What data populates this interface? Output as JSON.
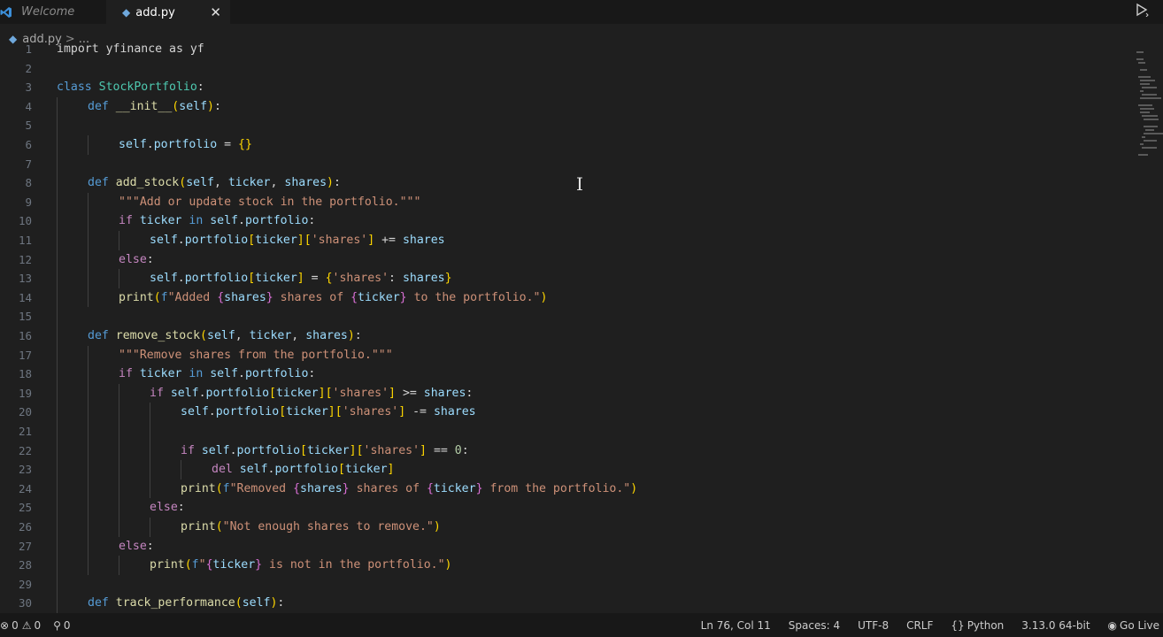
{
  "tabs": [
    {
      "label": "Welcome",
      "icon": "vscode-icon"
    },
    {
      "label": "add.py",
      "icon": "python-icon",
      "close": "✕"
    }
  ],
  "breadcrumb": {
    "file": "add.py",
    "separator": ">",
    "more": "..."
  },
  "code_lines": [
    {
      "n": "1",
      "indent": 0,
      "tokens": [
        [
          "plain",
          "import yfinance as yf"
        ]
      ]
    },
    {
      "n": "2",
      "indent": 0,
      "tokens": []
    },
    {
      "n": "3",
      "indent": 0,
      "tokens": [
        [
          "kw",
          "class "
        ],
        [
          "cls",
          "StockPortfolio"
        ],
        [
          "plain",
          ":"
        ]
      ]
    },
    {
      "n": "4",
      "indent": 1,
      "tokens": [
        [
          "kw",
          "def "
        ],
        [
          "fn",
          "__init__"
        ],
        [
          "brk",
          "("
        ],
        [
          "var",
          "self"
        ],
        [
          "brk",
          ")"
        ],
        [
          "plain",
          ":"
        ]
      ]
    },
    {
      "n": "5",
      "indent": 0,
      "tokens": []
    },
    {
      "n": "6",
      "indent": 2,
      "tokens": [
        [
          "var",
          "self"
        ],
        [
          "plain",
          "."
        ],
        [
          "var",
          "portfolio"
        ],
        [
          "plain",
          " = "
        ],
        [
          "brk",
          "{}"
        ]
      ]
    },
    {
      "n": "7",
      "indent": 0,
      "tokens": []
    },
    {
      "n": "8",
      "indent": 1,
      "tokens": [
        [
          "kw",
          "def "
        ],
        [
          "fn",
          "add_stock"
        ],
        [
          "brk",
          "("
        ],
        [
          "var",
          "self"
        ],
        [
          "plain",
          ", "
        ],
        [
          "var",
          "ticker"
        ],
        [
          "plain",
          ", "
        ],
        [
          "var",
          "shares"
        ],
        [
          "brk",
          ")"
        ],
        [
          "plain",
          ":"
        ]
      ]
    },
    {
      "n": "9",
      "indent": 2,
      "tokens": [
        [
          "str",
          "\"\"\"Add or update stock in the portfolio.\"\"\""
        ]
      ]
    },
    {
      "n": "10",
      "indent": 2,
      "tokens": [
        [
          "kw2",
          "if "
        ],
        [
          "var",
          "ticker"
        ],
        [
          "kw",
          " in "
        ],
        [
          "var",
          "self"
        ],
        [
          "plain",
          "."
        ],
        [
          "var",
          "portfolio"
        ],
        [
          "plain",
          ":"
        ]
      ]
    },
    {
      "n": "11",
      "indent": 3,
      "tokens": [
        [
          "var",
          "self"
        ],
        [
          "plain",
          "."
        ],
        [
          "var",
          "portfolio"
        ],
        [
          "brk",
          "["
        ],
        [
          "var",
          "ticker"
        ],
        [
          "brk",
          "]"
        ],
        [
          "brk",
          "["
        ],
        [
          "str",
          "'shares'"
        ],
        [
          "brk",
          "]"
        ],
        [
          "plain",
          " += "
        ],
        [
          "var",
          "shares"
        ]
      ]
    },
    {
      "n": "12",
      "indent": 2,
      "tokens": [
        [
          "kw2",
          "else"
        ],
        [
          "plain",
          ":"
        ]
      ]
    },
    {
      "n": "13",
      "indent": 3,
      "tokens": [
        [
          "var",
          "self"
        ],
        [
          "plain",
          "."
        ],
        [
          "var",
          "portfolio"
        ],
        [
          "brk",
          "["
        ],
        [
          "var",
          "ticker"
        ],
        [
          "brk",
          "]"
        ],
        [
          "plain",
          " = "
        ],
        [
          "brk",
          "{"
        ],
        [
          "str",
          "'shares'"
        ],
        [
          "plain",
          ": "
        ],
        [
          "var",
          "shares"
        ],
        [
          "brk",
          "}"
        ]
      ]
    },
    {
      "n": "14",
      "indent": 2,
      "tokens": [
        [
          "fn",
          "print"
        ],
        [
          "brk",
          "("
        ],
        [
          "kw",
          "f"
        ],
        [
          "str",
          "\"Added "
        ],
        [
          "brk2",
          "{"
        ],
        [
          "var",
          "shares"
        ],
        [
          "brk2",
          "}"
        ],
        [
          "str",
          " shares of "
        ],
        [
          "brk2",
          "{"
        ],
        [
          "var",
          "ticker"
        ],
        [
          "brk2",
          "}"
        ],
        [
          "str",
          " to the portfolio.\""
        ],
        [
          "brk",
          ")"
        ]
      ]
    },
    {
      "n": "15",
      "indent": 0,
      "tokens": []
    },
    {
      "n": "16",
      "indent": 1,
      "tokens": [
        [
          "kw",
          "def "
        ],
        [
          "fn",
          "remove_stock"
        ],
        [
          "brk",
          "("
        ],
        [
          "var",
          "self"
        ],
        [
          "plain",
          ", "
        ],
        [
          "var",
          "ticker"
        ],
        [
          "plain",
          ", "
        ],
        [
          "var",
          "shares"
        ],
        [
          "brk",
          ")"
        ],
        [
          "plain",
          ":"
        ]
      ]
    },
    {
      "n": "17",
      "indent": 2,
      "tokens": [
        [
          "str",
          "\"\"\"Remove shares from the portfolio.\"\"\""
        ]
      ]
    },
    {
      "n": "18",
      "indent": 2,
      "tokens": [
        [
          "kw2",
          "if "
        ],
        [
          "var",
          "ticker"
        ],
        [
          "kw",
          " in "
        ],
        [
          "var",
          "self"
        ],
        [
          "plain",
          "."
        ],
        [
          "var",
          "portfolio"
        ],
        [
          "plain",
          ":"
        ]
      ]
    },
    {
      "n": "19",
      "indent": 3,
      "tokens": [
        [
          "kw2",
          "if "
        ],
        [
          "var",
          "self"
        ],
        [
          "plain",
          "."
        ],
        [
          "var",
          "portfolio"
        ],
        [
          "brk",
          "["
        ],
        [
          "var",
          "ticker"
        ],
        [
          "brk",
          "]"
        ],
        [
          "brk",
          "["
        ],
        [
          "str",
          "'shares'"
        ],
        [
          "brk",
          "]"
        ],
        [
          "plain",
          " >= "
        ],
        [
          "var",
          "shares"
        ],
        [
          "plain",
          ":"
        ]
      ]
    },
    {
      "n": "20",
      "indent": 4,
      "tokens": [
        [
          "var",
          "self"
        ],
        [
          "plain",
          "."
        ],
        [
          "var",
          "portfolio"
        ],
        [
          "brk",
          "["
        ],
        [
          "var",
          "ticker"
        ],
        [
          "brk",
          "]"
        ],
        [
          "brk",
          "["
        ],
        [
          "str",
          "'shares'"
        ],
        [
          "brk",
          "]"
        ],
        [
          "plain",
          " -= "
        ],
        [
          "var",
          "shares"
        ]
      ]
    },
    {
      "n": "21",
      "indent": 0,
      "tokens": []
    },
    {
      "n": "22",
      "indent": 4,
      "tokens": [
        [
          "kw2",
          "if "
        ],
        [
          "var",
          "self"
        ],
        [
          "plain",
          "."
        ],
        [
          "var",
          "portfolio"
        ],
        [
          "brk",
          "["
        ],
        [
          "var",
          "ticker"
        ],
        [
          "brk",
          "]"
        ],
        [
          "brk",
          "["
        ],
        [
          "str",
          "'shares'"
        ],
        [
          "brk",
          "]"
        ],
        [
          "plain",
          " == "
        ],
        [
          "num",
          "0"
        ],
        [
          "plain",
          ":"
        ]
      ]
    },
    {
      "n": "23",
      "indent": 5,
      "tokens": [
        [
          "kw2",
          "del "
        ],
        [
          "var",
          "self"
        ],
        [
          "plain",
          "."
        ],
        [
          "var",
          "portfolio"
        ],
        [
          "brk",
          "["
        ],
        [
          "var",
          "ticker"
        ],
        [
          "brk",
          "]"
        ]
      ]
    },
    {
      "n": "24",
      "indent": 4,
      "tokens": [
        [
          "fn",
          "print"
        ],
        [
          "brk",
          "("
        ],
        [
          "kw",
          "f"
        ],
        [
          "str",
          "\"Removed "
        ],
        [
          "brk2",
          "{"
        ],
        [
          "var",
          "shares"
        ],
        [
          "brk2",
          "}"
        ],
        [
          "str",
          " shares of "
        ],
        [
          "brk2",
          "{"
        ],
        [
          "var",
          "ticker"
        ],
        [
          "brk2",
          "}"
        ],
        [
          "str",
          " from the portfolio.\""
        ],
        [
          "brk",
          ")"
        ]
      ]
    },
    {
      "n": "25",
      "indent": 3,
      "tokens": [
        [
          "kw2",
          "else"
        ],
        [
          "plain",
          ":"
        ]
      ]
    },
    {
      "n": "26",
      "indent": 4,
      "tokens": [
        [
          "fn",
          "print"
        ],
        [
          "brk",
          "("
        ],
        [
          "str",
          "\"Not enough shares to remove.\""
        ],
        [
          "brk",
          ")"
        ]
      ]
    },
    {
      "n": "27",
      "indent": 2,
      "tokens": [
        [
          "kw2",
          "else"
        ],
        [
          "plain",
          ":"
        ]
      ]
    },
    {
      "n": "28",
      "indent": 3,
      "tokens": [
        [
          "fn",
          "print"
        ],
        [
          "brk",
          "("
        ],
        [
          "kw",
          "f"
        ],
        [
          "str",
          "\""
        ],
        [
          "brk2",
          "{"
        ],
        [
          "var",
          "ticker"
        ],
        [
          "brk2",
          "}"
        ],
        [
          "str",
          " is not in the portfolio.\""
        ],
        [
          "brk",
          ")"
        ]
      ]
    },
    {
      "n": "29",
      "indent": 0,
      "tokens": []
    },
    {
      "n": "30",
      "indent": 1,
      "tokens": [
        [
          "kw",
          "def "
        ],
        [
          "fn",
          "track_performance"
        ],
        [
          "brk",
          "("
        ],
        [
          "var",
          "self"
        ],
        [
          "brk",
          ")"
        ],
        [
          "plain",
          ":"
        ]
      ]
    }
  ],
  "status": {
    "errors": "0",
    "warnings": "0",
    "ports": "0",
    "position": "Ln 76, Col 11",
    "spaces": "Spaces: 4",
    "encoding": "UTF-8",
    "eol": "CRLF",
    "language": "Python",
    "interpreter": "3.13.0 64-bit",
    "golive": "Go Live"
  },
  "colors": {
    "editor_bg": "#1f1f1f",
    "keyword": "#569cd6",
    "control": "#c586c0",
    "class": "#4ec9b0",
    "function": "#dcdcaa",
    "variable": "#9cdcfe",
    "string": "#ce9178"
  }
}
